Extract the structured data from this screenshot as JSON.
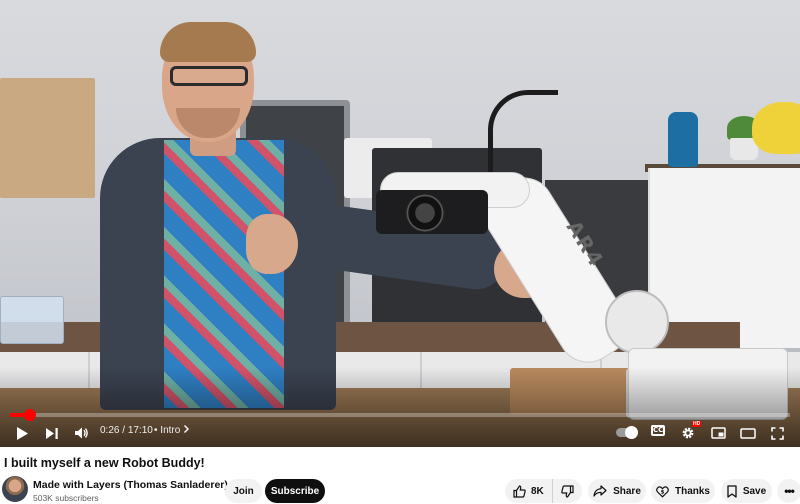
{
  "player": {
    "progress_fraction": 0.0252,
    "time_current": "0:26",
    "time_separator": "/",
    "time_total": "17:10",
    "chapter_separator": "•",
    "chapter": "Intro",
    "cc_label": "CC",
    "hd_badge": "HD",
    "robot_logo_text": "AR4",
    "accent_color": "#ff0000"
  },
  "video": {
    "title": "I built myself a new Robot Buddy!"
  },
  "channel": {
    "name": "Made with Layers (Thomas Sanladerer)",
    "subscribers": "503K subscribers",
    "join_label": "Join",
    "subscribe_label": "Subscribe"
  },
  "actions": {
    "likes": "8K",
    "share_label": "Share",
    "thanks_label": "Thanks",
    "save_label": "Save",
    "more_label": "•••"
  },
  "icons": {
    "play": "play-icon",
    "next": "next-icon",
    "volume": "volume-icon",
    "chapter_chevron": "chevron-right-icon",
    "autoplay": "autoplay-toggle-icon",
    "captions": "captions-icon",
    "settings": "gear-icon",
    "miniplayer": "miniplayer-icon",
    "theater": "theater-mode-icon",
    "fullscreen": "fullscreen-icon",
    "like": "thumbs-up-icon",
    "dislike": "thumbs-down-icon",
    "share": "share-arrow-icon",
    "thanks": "thanks-heart-icon",
    "save": "bookmark-icon"
  }
}
